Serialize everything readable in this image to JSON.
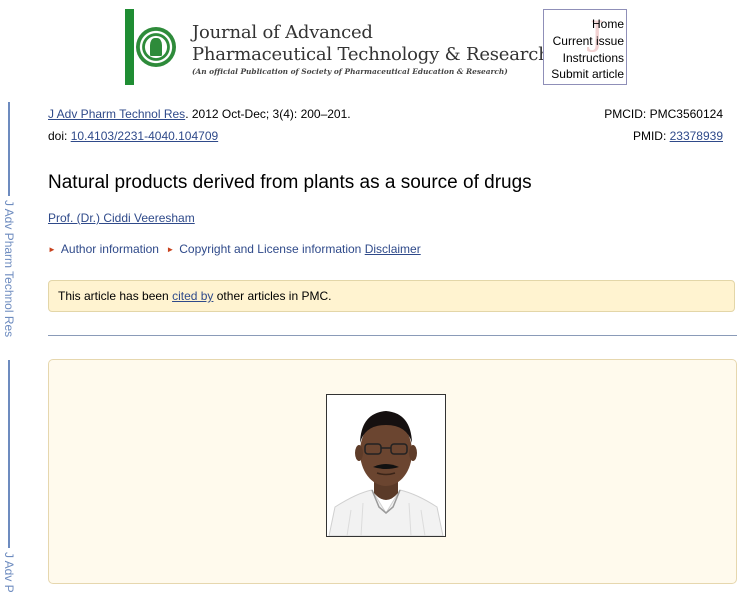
{
  "journal": {
    "title_line1": "Journal of Advanced",
    "title_line2": "Pharmaceutical Technology & Research",
    "subtitle": "(An official Publication of Society of Pharmaceutical Education & Research)",
    "nav": [
      "Home",
      "Current issue",
      "Instructions",
      "Submit article"
    ]
  },
  "side_label": {
    "text": "J Adv Pharm Technol Res",
    "text_short": "J Adv P"
  },
  "citation": {
    "journal_abbrev": "J Adv Pharm Technol Res",
    "details": ". 2012 Oct-Dec; 3(4): 200–201.",
    "doi_label": "doi: ",
    "doi": "10.4103/2231-4040.104709",
    "pmcid_label": "PMCID: ",
    "pmcid": "PMC3560124",
    "pmid_label": "PMID: ",
    "pmid": "23378939"
  },
  "article": {
    "title": "Natural products derived from plants as a source of drugs",
    "author": "Prof. (Dr.) Ciddi Veeresham",
    "author_info": "Author information",
    "copyright": "Copyright and License information",
    "disclaimer": "Disclaimer"
  },
  "notice": {
    "prefix": "This article has been ",
    "link": "cited by",
    "suffix": " other articles in PMC."
  },
  "colors": {
    "link": "#2f4a8a",
    "notice_bg": "#fff3d0",
    "content_bg": "#fffaed",
    "brand_green": "#1f8d33",
    "side_blue": "#6d8bbf"
  }
}
